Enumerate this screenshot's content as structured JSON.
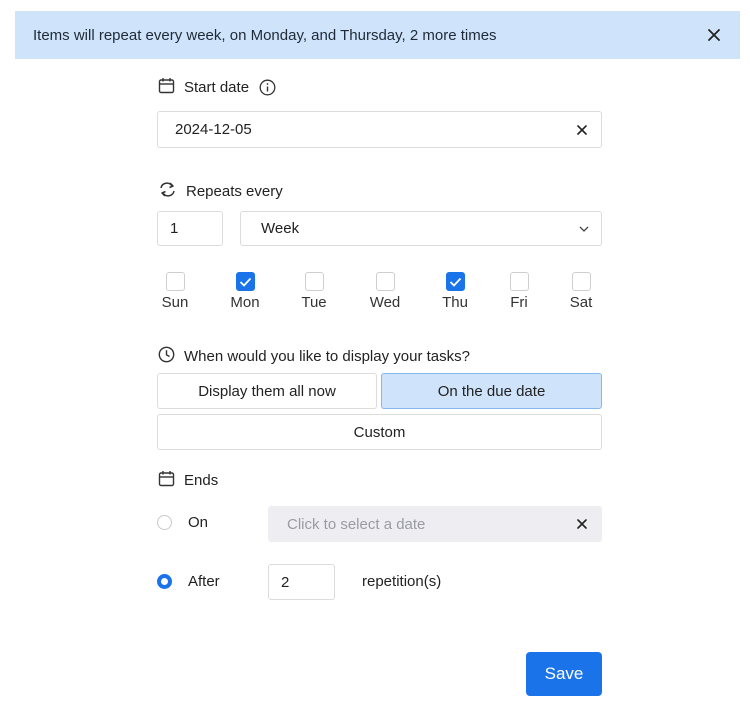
{
  "banner": {
    "text": "Items will repeat every week, on Monday, and Thursday, 2 more times"
  },
  "start_date": {
    "label": "Start date",
    "value": "2024-12-05"
  },
  "repeats": {
    "label": "Repeats every",
    "interval": "1",
    "unit": "Week",
    "days": [
      {
        "label": "Sun",
        "checked": false
      },
      {
        "label": "Mon",
        "checked": true
      },
      {
        "label": "Tue",
        "checked": false
      },
      {
        "label": "Wed",
        "checked": false
      },
      {
        "label": "Thu",
        "checked": true
      },
      {
        "label": "Fri",
        "checked": false
      },
      {
        "label": "Sat",
        "checked": false
      }
    ]
  },
  "display": {
    "question": "When would you like to display your tasks?",
    "options": [
      "Display them all now",
      "On the due date",
      "Custom"
    ],
    "selected": "On the due date"
  },
  "ends": {
    "label": "Ends",
    "on_label": "On",
    "on_placeholder": "Click to select a date",
    "after_label": "After",
    "after_count": "2",
    "after_suffix": "repetition(s)",
    "selected": "After"
  },
  "save_label": "Save",
  "colors": {
    "accent": "#1a73e8",
    "banner_bg": "#cfe4fb",
    "selected_bg": "#cfe4fb"
  }
}
